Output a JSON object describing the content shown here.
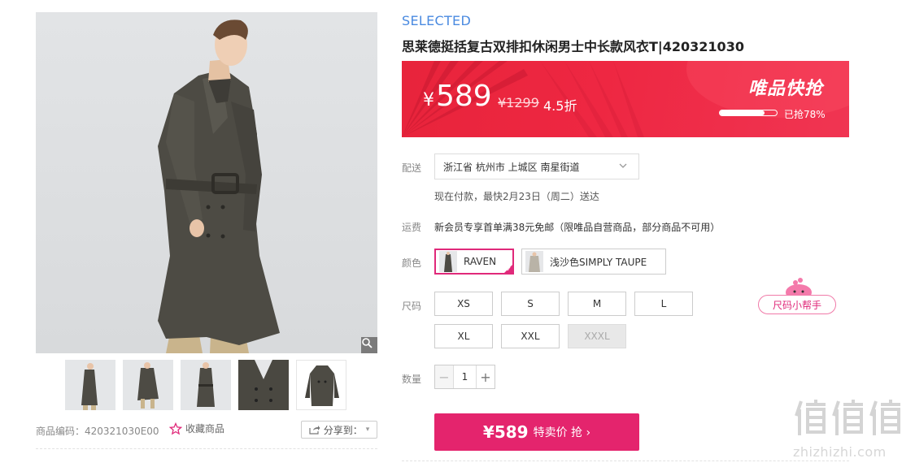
{
  "gallery": {
    "main_image": "man-in-olive-trench-coat",
    "zoom_icon": "magnifier-icon",
    "thumbnails": [
      "front-view",
      "full-body-walk",
      "belted-view",
      "collar-detail",
      "flat-lay-coat"
    ]
  },
  "meta": {
    "goods_code": "商品编码：420321030E00",
    "favorite_label": "收藏商品",
    "share_label": "分享到："
  },
  "product": {
    "brand": "SELECTED",
    "title": "思莱德挺括复古双排扣休闲男士中长款风衣T|420321030"
  },
  "price": {
    "currency": "¥",
    "sale": "589",
    "original": "¥1299",
    "discount": "4.5折",
    "flash_title": "唯品快抢",
    "sold_label": "已抢78%",
    "sold_fraction": 0.78
  },
  "delivery": {
    "label": "配送",
    "address": "浙江省 杭州市 上城区 南星街道",
    "note": "现在付款，最快2月23日（周二）送达"
  },
  "shipping": {
    "label": "运费",
    "text": "新会员专享首单满38元免邮（限唯品自营商品，部分商品不可用）"
  },
  "colors": {
    "label": "颜色",
    "options": [
      {
        "name": "RAVEN",
        "selected": true
      },
      {
        "name": "浅沙色SIMPLY TAUPE",
        "selected": false
      }
    ]
  },
  "sizes": {
    "label": "尺码",
    "options": [
      "XS",
      "S",
      "M",
      "L",
      "XL",
      "XXL",
      "XXXL"
    ],
    "unavailable": [
      "XXXL"
    ],
    "helper": "尺码小帮手"
  },
  "quantity": {
    "label": "数量",
    "value": "1"
  },
  "buy": {
    "price": "¥589",
    "label": "特卖价 抢 ›"
  },
  "watermark": {
    "logo": "值值值",
    "url": "zhizhizhi.com"
  },
  "colors_theme": {
    "accent": "#e4246d",
    "banner": "#ee2742",
    "brand_blue": "#4a8ae0"
  }
}
